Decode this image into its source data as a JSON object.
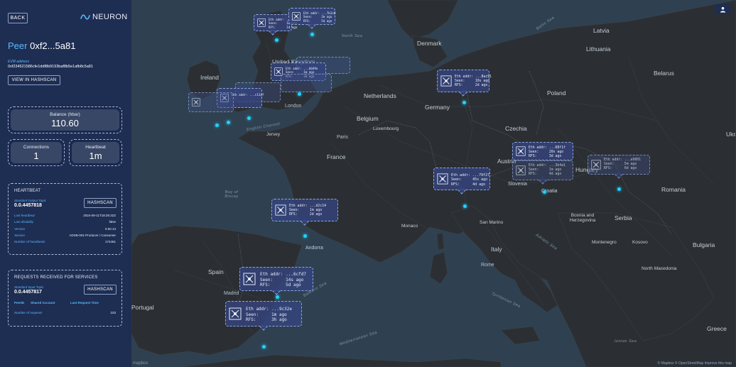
{
  "app": {
    "back_label": "BACK",
    "brand": "NEURON"
  },
  "peer": {
    "title_prefix": "Peer",
    "title_address": "0xf2...5a81",
    "evm_label": "EVM address",
    "evm_address": "0xf234521586cfe1ddf8b9193baf8b5e1afb8c5a81",
    "view_hashscan_label": "VIEW IN HASHSCAN"
  },
  "stats": {
    "balance_label": "Balance (hbar)",
    "balance_value": "110.60",
    "connections_label": "Connections",
    "connections_value": "1",
    "heartbeat_label": "Heartbeat",
    "heartbeat_value": "1m"
  },
  "heartbeat_section": {
    "title": "HEARTBEAT",
    "topic_label": "Standard Output Topic",
    "topic_value": "0.0.4457818",
    "hashscan_label": "HASHSCAN",
    "rows": [
      {
        "key": "Last heartbeat",
        "value": "2024-09-11T18:26:32Z"
      },
      {
        "key": "Last disability",
        "value": "false"
      },
      {
        "key": "Version",
        "value": "0.50.13"
      },
      {
        "key": "Service",
        "value": "ADSB-001-Producer / Consumer"
      },
      {
        "key": "Number of heartbeats",
        "value": "174461"
      }
    ]
  },
  "requests_section": {
    "title": "REQUESTS RECEIVED FOR SERVICES",
    "topic_label": "Standard Input Topic",
    "topic_value": "0.0.4457817",
    "hashscan_label": "HASHSCAN",
    "columns": [
      "PeerID",
      "Shared Account",
      "Last Request Time"
    ],
    "requests_label": "Number of requests",
    "requests_value": "233"
  },
  "map": {
    "countries": [
      "Latvia",
      "Lithuania",
      "Denmark",
      "Belarus",
      "Ireland",
      "United Kingdom",
      "Netherlands",
      "Poland",
      "Germany",
      "Belgium",
      "Luxembourg",
      "Czechia",
      "France",
      "Austria",
      "Hungary",
      "Slovenia",
      "Croatia",
      "Romania",
      "Bosnia and Herzegovina",
      "Serbia",
      "Monaco",
      "San Marino",
      "Andorra",
      "Italy",
      "Montenegro",
      "Kosovo",
      "Bulgaria",
      "North Macedonia",
      "Spain",
      "Portugal",
      "Greece",
      "Ukraine",
      "Jersey"
    ],
    "cities": [
      "London",
      "Paris",
      "Madrid",
      "Rome"
    ],
    "seas": [
      "Baltic Sea",
      "North Sea",
      "English Channel",
      "Bay of Biscay",
      "Balearic Sea",
      "Adriatic Sea",
      "Tyrrhenian Sea",
      "Mediterranean Sea",
      "Ionian Sea"
    ],
    "attribution": "© Mapbox © OpenStreetMap Improve this map",
    "mapbox_label": "mapbox",
    "markers": [
      {
        "line1": "Eth addr: ...6cfd7",
        "line2": "Seen:     14s ago",
        "line3": "RFS:      5d ago"
      },
      {
        "line1": "Eth addr: ...9c32e",
        "line2": "Seen:     1m ago",
        "line3": "RFS:      3h ago"
      },
      {
        "line1": "Eth addr: ...79f27",
        "line2": "Seen:     45s ago",
        "line3": "RFS:      4d ago"
      },
      {
        "line1": "Eth addr: ...68f1f",
        "line2": "Seen:     20s ago",
        "line3": "RFS:      3d ago"
      },
      {
        "line1": "Eth addr: ...3b4a1",
        "line2": "Seen:     1m ago",
        "line3": "RFS:      4d ago"
      },
      {
        "line1": "Eth addr: ...a9801",
        "line2": "Seen:     5m ago",
        "line3": "RFS:      6d ago"
      },
      {
        "line1": "Eth addr: ...8ac91",
        "line2": "Seen:     10s ago",
        "line3": "RFS:      2d ago"
      },
      {
        "line1": "Eth addr: ...d2c14",
        "line2": "Seen:     1m ago",
        "line3": "RFS:      2d ago"
      },
      {
        "line1": "Eth addr: ...e5a81",
        "line2": "Seen:     1m ago",
        "line3": "RFS:      1d ago"
      },
      {
        "line1": "Eth addr: ...7b3c0",
        "line2": "Seen:     2m ago",
        "line3": "RFS:      5d ago"
      },
      {
        "line1": "Eth addr: ...b0d9e",
        "line2": "Seen:     1m ago",
        "line3": "RFS:      3d ago"
      },
      {
        "line1": "Eth addr: ...c12ef",
        "line2": "Seen:     30s ago",
        "line3": "RFS:      1d ago"
      }
    ]
  }
}
